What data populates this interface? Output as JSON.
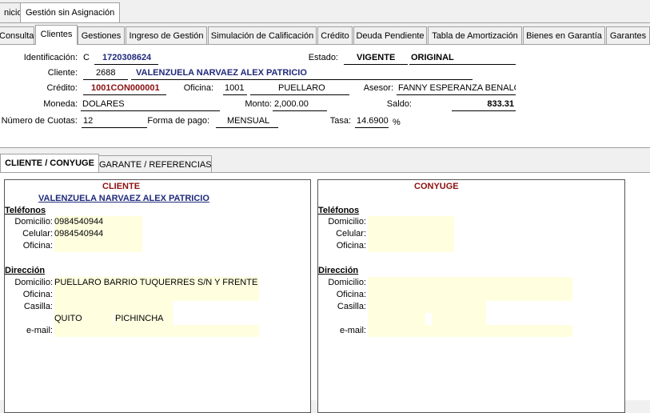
{
  "top_tabs": [
    "nicio",
    "Gestión sin Asignación"
  ],
  "tabs": [
    "Consulta",
    "Clientes",
    "Gestiones",
    "Ingreso de Gestión",
    "Simulación de Calificación",
    "Crédito",
    "Deuda Pendiente",
    "Tabla de Amortización",
    "Bienes en Garantía",
    "Garantes"
  ],
  "header": {
    "identificacion_label": "Identificación:",
    "identificacion_tipo": "C",
    "identificacion_numero": "1720308624",
    "estado_label": "Estado:",
    "estado_valor": "VIGENTE",
    "estado_tipo": "ORIGINAL",
    "cliente_label": "Cliente:",
    "cliente_codigo": "2688",
    "cliente_nombre": "VALENZUELA NARVAEZ ALEX PATRICIO",
    "credito_label": "Crédito:",
    "credito_valor": "1001CON000001",
    "oficina_label": "Oficina:",
    "oficina_codigo": "1001",
    "oficina_nombre": "PUELLARO",
    "asesor_label": "Asesor:",
    "asesor_valor": "FANNY ESPERANZA BENALCAZAR",
    "moneda_label": "Moneda:",
    "moneda_valor": "DOLARES",
    "monto_label": "Monto:",
    "monto_valor": "2,000.00",
    "saldo_label": "Saldo:",
    "saldo_valor": "833.31",
    "cuotas_label": "Número de Cuotas:",
    "cuotas_valor": "12",
    "forma_pago_label": "Forma de pago:",
    "forma_pago_valor": "MENSUAL",
    "tasa_label": "Tasa:",
    "tasa_valor": "14.6900",
    "tasa_unidad": "%"
  },
  "sub_tabs": [
    "CLIENTE / CONYUGE",
    "GARANTE / REFERENCIAS"
  ],
  "cliente_panel": {
    "title": "CLIENTE",
    "nombre": "VALENZUELA NARVAEZ ALEX PATRICIO",
    "telefonos_label": "Teléfonos",
    "domicilio_label": "Domicilio:",
    "domicilio_tel": "0984540944",
    "celular_label": "Celular:",
    "celular_tel": "0984540944",
    "oficina_label": "Oficina:",
    "oficina_tel": "",
    "direccion_label": "Dirección",
    "dir_domicilio_label": "Domicilio:",
    "dir_domicilio": "PUELLARO BARRIO TUQUERRES S/N Y FRENTE A CO",
    "dir_oficina_label": "Oficina:",
    "dir_oficina": "",
    "casilla_label": "Casilla:",
    "casilla": "",
    "ciudad": "QUITO",
    "provincia": "PICHINCHA",
    "email_label": "e-mail:",
    "email": ""
  },
  "conyuge_panel": {
    "title": "CONYUGE",
    "telefonos_label": "Teléfonos",
    "domicilio_label": "Domicilio:",
    "celular_label": "Celular:",
    "oficina_label": "Oficina:",
    "direccion_label": "Dirección",
    "dir_domicilio_label": "Domicilio:",
    "dir_oficina_label": "Oficina:",
    "casilla_label": "Casilla:",
    "email_label": "e-mail:"
  }
}
